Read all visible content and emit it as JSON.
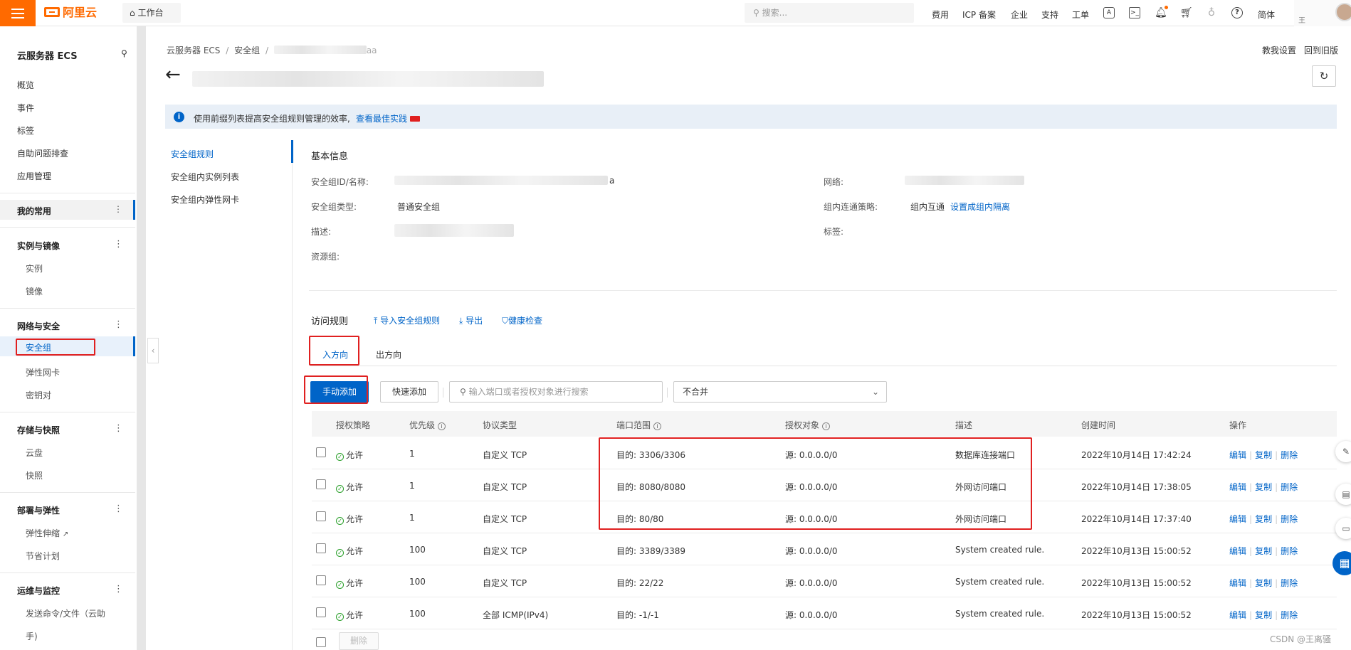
{
  "topbar": {
    "logo": "阿里云",
    "workbench": "工作台",
    "search_placeholder": "搜索...",
    "nav": [
      "费用",
      "ICP 备案",
      "企业",
      "支持",
      "工单"
    ],
    "lang": "简体",
    "user_initial": "王"
  },
  "sidebar": {
    "title": "云服务器 ECS",
    "items": [
      "概览",
      "事件",
      "标签",
      "自助问题排查",
      "应用管理"
    ],
    "favorites": "我的常用",
    "groups": [
      {
        "label": "实例与镜像",
        "subs": [
          "实例",
          "镜像"
        ]
      },
      {
        "label": "网络与安全",
        "subs": [
          "安全组",
          "弹性网卡",
          "密钥对"
        ]
      },
      {
        "label": "存储与快照",
        "subs": [
          "云盘",
          "快照"
        ]
      },
      {
        "label": "部署与弹性",
        "subs": [
          "弹性伸缩",
          "节省计划"
        ]
      },
      {
        "label": "运维与监控",
        "subs": [
          "发送命令/文件（云助",
          "手)"
        ]
      }
    ]
  },
  "breadcrumb": [
    "云服务器 ECS",
    "/",
    "安全组",
    "/"
  ],
  "breadcrumb_tail": "aa",
  "header_links": {
    "tutorial": "教我设置",
    "old_version": "回到旧版"
  },
  "notice": {
    "text": "使用前缀列表提高安全组规则管理的效率,",
    "link": "查看最佳实践"
  },
  "subnav": [
    "安全组规则",
    "安全组内实例列表",
    "安全组内弹性网卡"
  ],
  "basic": {
    "title": "基本信息",
    "id_label": "安全组ID/名称:",
    "id_tail": "a",
    "type_label": "安全组类型:",
    "type_value": "普通安全组",
    "desc_label": "描述:",
    "rg_label": "资源组:",
    "net_label": "网络:",
    "policy_label": "组内连通策略:",
    "policy_value": "组内互通",
    "policy_link": "设置成组内隔离",
    "tag_label": "标签:"
  },
  "rules": {
    "title": "访问规则",
    "import": "导入安全组规则",
    "export": "导出",
    "health": "健康检查",
    "tab_in": "入方向",
    "tab_out": "出方向",
    "add_btn": "手动添加",
    "quick_btn": "快速添加",
    "search_placeholder": "输入端口或者授权对象进行搜索",
    "merge": "不合并",
    "delete_btn": "删除"
  },
  "table": {
    "headers": [
      "授权策略",
      "优先级",
      "协议类型",
      "端口范围",
      "授权对象",
      "描述",
      "创建时间",
      "操作"
    ],
    "rows": [
      {
        "policy": "允许",
        "priority": "1",
        "protocol": "自定义 TCP",
        "port": "目的: 3306/3306",
        "source": "源: 0.0.0.0/0",
        "desc": "数据库连接端口",
        "time": "2022年10月14日 17:42:24"
      },
      {
        "policy": "允许",
        "priority": "1",
        "protocol": "自定义 TCP",
        "port": "目的: 8080/8080",
        "source": "源: 0.0.0.0/0",
        "desc": "外网访问端口",
        "time": "2022年10月14日 17:38:05"
      },
      {
        "policy": "允许",
        "priority": "1",
        "protocol": "自定义 TCP",
        "port": "目的: 80/80",
        "source": "源: 0.0.0.0/0",
        "desc": "外网访问端口",
        "time": "2022年10月14日 17:37:40"
      },
      {
        "policy": "允许",
        "priority": "100",
        "protocol": "自定义 TCP",
        "port": "目的: 3389/3389",
        "source": "源: 0.0.0.0/0",
        "desc": "System created rule.",
        "time": "2022年10月13日 15:00:52"
      },
      {
        "policy": "允许",
        "priority": "100",
        "protocol": "自定义 TCP",
        "port": "目的: 22/22",
        "source": "源: 0.0.0.0/0",
        "desc": "System created rule.",
        "time": "2022年10月13日 15:00:52"
      },
      {
        "policy": "允许",
        "priority": "100",
        "protocol": "全部 ICMP(IPv4)",
        "port": "目的: -1/-1",
        "source": "源: 0.0.0.0/0",
        "desc": "System created rule.",
        "time": "2022年10月13日 15:00:52"
      }
    ],
    "ops": [
      "编辑",
      "复制",
      "删除"
    ]
  },
  "watermark": "CSDN @王离骚"
}
